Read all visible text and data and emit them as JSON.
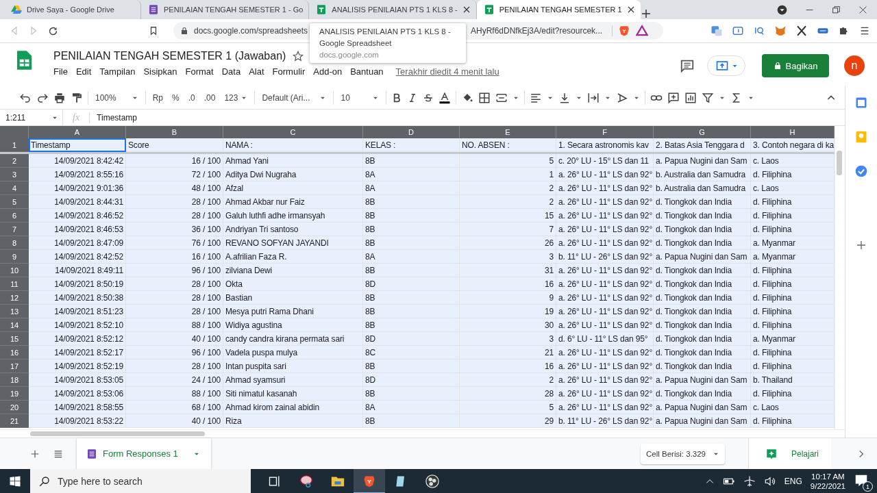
{
  "browser": {
    "tabs": [
      {
        "kind": "drive",
        "title": "Drive Saya - Google Drive",
        "selected": false,
        "hovered": false
      },
      {
        "kind": "forms",
        "title": "PENILAIAN TENGAH SEMESTER 1 - Go",
        "selected": false,
        "hovered": false
      },
      {
        "kind": "sheets",
        "title": "ANALISIS PENILAIAN PTS 1 KLS 8 -",
        "selected": false,
        "hovered": true
      },
      {
        "kind": "sheets",
        "title": "PENILAIAN TENGAH SEMESTER 1",
        "selected": true,
        "hovered": false
      }
    ],
    "address_start": "docs.google.com/spreadsheets",
    "address_end": "AHyRf6dDNfkEj3A/edit?resourcek...",
    "tooltip": {
      "title": "ANALISIS PENILAIAN PTS 1 KLS 8 -",
      "subtitle": "Google Spreadsheet",
      "host": "docs.google.com"
    }
  },
  "doc": {
    "title": "PENILAIAN TENGAH SEMESTER 1 (Jawaban)",
    "menus": [
      "File",
      "Edit",
      "Tampilan",
      "Sisipkan",
      "Format",
      "Data",
      "Alat",
      "Formulir",
      "Add-on",
      "Bantuan"
    ],
    "last_edit": "Terakhir diedit 4 menit lalu",
    "share": "Bagikan",
    "avatar": "n"
  },
  "toolbar": {
    "zoom": "100%",
    "currency": "Rp",
    "percent": "%",
    "dec_less": ".0",
    "dec_more": ".00",
    "number_format": "123",
    "font": "Default (Ari...",
    "font_size": "10"
  },
  "formula_bar": {
    "range": "1:211",
    "fx": "fx",
    "value": "Timestamp"
  },
  "sheet": {
    "columns": [
      {
        "label": "A",
        "selected": true
      },
      {
        "label": "B",
        "selected": true
      },
      {
        "label": "C",
        "selected": true
      },
      {
        "label": "D",
        "selected": true
      },
      {
        "label": "E",
        "selected": true
      },
      {
        "label": "F",
        "selected": true
      },
      {
        "label": "G",
        "selected": true
      },
      {
        "label": "H",
        "selected": true
      }
    ],
    "rows": [
      {
        "number": "1",
        "selected": true,
        "first_cell_active": true,
        "cells": [
          "Timestamp",
          "Score",
          "NAMA :",
          "KELAS :",
          "NO. ABSEN :",
          "1. Secara astronomis kav",
          "2. Batas Asia Tenggara d",
          "3. Contoh negara di ka"
        ]
      },
      {
        "number": "2",
        "selected": true,
        "cells": [
          "14/09/2021 8:42:42",
          "16 / 100",
          "Ahmad Yani",
          "8B",
          "5",
          "c. 20° LU - 15° LS dan 11",
          "a. Papua Nugini dan Sam",
          "c. Laos"
        ]
      },
      {
        "number": "3",
        "selected": true,
        "cells": [
          "14/09/2021 8:55:16",
          "72 / 100",
          "Aditya Dwi Nugraha",
          "8A",
          "1",
          "a. 26° LU - 11° LS dan 92°",
          "b. Australia dan Samudra",
          "d. Filiphina"
        ]
      },
      {
        "number": "4",
        "selected": true,
        "cells": [
          "14/09/2021 9:01:36",
          "48 / 100",
          "Afzal",
          "8A",
          "2",
          "a. 26° LU - 11° LS dan 92°",
          "b. Australia dan Samudra",
          "c. Laos"
        ]
      },
      {
        "number": "5",
        "selected": true,
        "cells": [
          "14/09/2021 8:44:31",
          "28 / 100",
          "Ahmad Akbar nur Faiz",
          "8B",
          "2",
          "a. 26° LU - 11° LS dan 92°",
          "d. Tiongkok dan India",
          "d. Filiphina"
        ]
      },
      {
        "number": "6",
        "selected": true,
        "cells": [
          "14/09/2021 8:46:52",
          "28 / 100",
          "Galuh luthfi adhe irmansyah",
          "8B",
          "15",
          "a. 26° LU - 11° LS dan 92°",
          "d. Tiongkok dan India",
          "d. Filiphina"
        ]
      },
      {
        "number": "7",
        "selected": true,
        "cells": [
          "14/09/2021 8:46:53",
          "36 / 100",
          "Andriyan Tri santoso",
          "8B",
          "7",
          "a. 26° LU - 11° LS dan 92°",
          "d. Tiongkok dan India",
          "d. Filiphina"
        ]
      },
      {
        "number": "8",
        "selected": true,
        "cells": [
          "14/09/2021 8:47:09",
          "76 / 100",
          "REVANO SOFYAN JAYANDI",
          "8B",
          "26",
          "a. 26° LU - 11° LS dan 92°",
          "d. Tiongkok dan India",
          "a. Myanmar"
        ]
      },
      {
        "number": "9",
        "selected": true,
        "cells": [
          "14/09/2021 8:42:52",
          "16 / 100",
          "A.afrilian Faza R.",
          "8A",
          "3",
          "b. 11° LU - 26° LS dan 92°",
          "a. Papua Nugini dan Sam",
          "a. Myanmar"
        ]
      },
      {
        "number": "10",
        "selected": true,
        "cells": [
          "14/09/2021 8:49:11",
          "96 / 100",
          "zilviana Dewi",
          "8B",
          "31",
          "a. 26° LU - 11° LS dan 92°",
          "d. Tiongkok dan India",
          "d. Filiphina"
        ]
      },
      {
        "number": "11",
        "selected": true,
        "cells": [
          "14/09/2021 8:50:19",
          "28 / 100",
          "Okta",
          "8D",
          "16",
          "a. 26° LU - 11° LS dan 92°",
          "d. Tiongkok dan India",
          "d. Filiphina"
        ]
      },
      {
        "number": "12",
        "selected": true,
        "cells": [
          "14/09/2021 8:50:38",
          "28 / 100",
          "Bastian",
          "8B",
          "9",
          "a. 26° LU - 11° LS dan 92°",
          "d. Tiongkok dan India",
          "d. Filiphina"
        ]
      },
      {
        "number": "13",
        "selected": true,
        "cells": [
          "14/09/2021 8:51:23",
          "28 / 100",
          "Mesya putri Rama Dhani",
          "8B",
          "19",
          "a. 26° LU - 11° LS dan 92°",
          "d. Tiongkok dan India",
          "d. Filiphina"
        ]
      },
      {
        "number": "14",
        "selected": true,
        "cells": [
          "14/09/2021 8:52:10",
          "88 / 100",
          "Widiya agustina",
          "8B",
          "30",
          "a. 26° LU - 11° LS dan 92°",
          "d. Tiongkok dan India",
          "d. Filiphina"
        ]
      },
      {
        "number": "15",
        "selected": true,
        "cells": [
          "14/09/2021 8:52:12",
          "40 / 100",
          "candy candra kirana permata sari",
          "8D",
          "3",
          "d. 6° LU - 11° LS dan 95°",
          "d. Tiongkok dan India",
          "a. Myanmar"
        ]
      },
      {
        "number": "16",
        "selected": true,
        "cells": [
          "14/09/2021 8:52:17",
          "96 / 100",
          "Vadela puspa mulya",
          "8C",
          "21",
          "a. 26° LU - 11° LS dan 92°",
          "d. Tiongkok dan India",
          "d. Filiphina"
        ]
      },
      {
        "number": "17",
        "selected": true,
        "cells": [
          "14/09/2021 8:52:19",
          "28 / 100",
          "Intan puspita sari",
          "8B",
          "16",
          "a. 26° LU - 11° LS dan 92°",
          "d. Tiongkok dan India",
          "d. Filiphina"
        ]
      },
      {
        "number": "18",
        "selected": true,
        "cells": [
          "14/09/2021 8:53:05",
          "24 / 100",
          "Ahmad syamsuri",
          "8D",
          "2",
          "a. 26° LU - 11° LS dan 92°",
          "a. Papua Nugini dan Sam",
          "b. Thailand"
        ]
      },
      {
        "number": "19",
        "selected": true,
        "cells": [
          "14/09/2021 8:53:06",
          "88 / 100",
          "Siti nimatul kasanah",
          "8B",
          "28",
          "a. 26° LU - 11° LS dan 92°",
          "d. Tiongkok dan India",
          "d. Filiphina"
        ]
      },
      {
        "number": "20",
        "selected": true,
        "cells": [
          "14/09/2021 8:58:55",
          "68 / 100",
          "Ahmad kirom zainal abidin",
          "8A",
          "5",
          "a. 26° LU - 11° LS dan 92°",
          "a. Papua Nugini dan Sam",
          "c. Laos"
        ]
      },
      {
        "number": "21",
        "selected": true,
        "cells": [
          "14/09/2021 8:53:22",
          "40 / 100",
          "Riza",
          "8B",
          "29",
          "b. 11° LU - 26° LS dan 92°",
          "a. Papua Nugini dan Sam",
          "d. Filiphina"
        ]
      }
    ]
  },
  "sheet_tabs": [
    {
      "label": "Form Responses 1",
      "selected": true
    }
  ],
  "status": {
    "summary": "Cell Berisi: 3.329",
    "explore": "Pelajari"
  },
  "taskbar": {
    "search_placeholder": "Type here to search",
    "language": "ENG",
    "time": "10:17 AM",
    "date": "9/22/2021",
    "notifications": "1"
  }
}
